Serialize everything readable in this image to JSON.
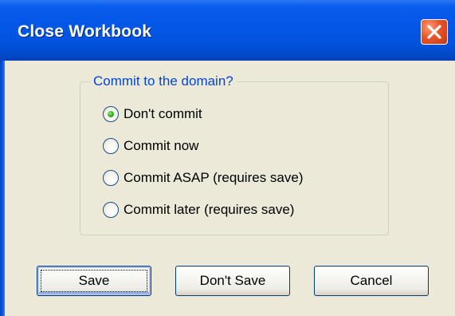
{
  "window": {
    "title": "Close Workbook"
  },
  "group": {
    "legend": "Commit to the domain?",
    "options": [
      {
        "label": "Don't commit",
        "checked": true
      },
      {
        "label": "Commit now",
        "checked": false
      },
      {
        "label": "Commit ASAP (requires save)",
        "checked": false
      },
      {
        "label": "Commit later (requires save)",
        "checked": false
      }
    ]
  },
  "buttons": {
    "save": "Save",
    "dont_save": "Don't Save",
    "cancel": "Cancel"
  },
  "icons": {
    "close": "close-icon"
  },
  "colors": {
    "titlebar": "#0457e6",
    "client": "#ece9d8",
    "legend_text": "#0046d5",
    "close_button": "#e8542a"
  }
}
